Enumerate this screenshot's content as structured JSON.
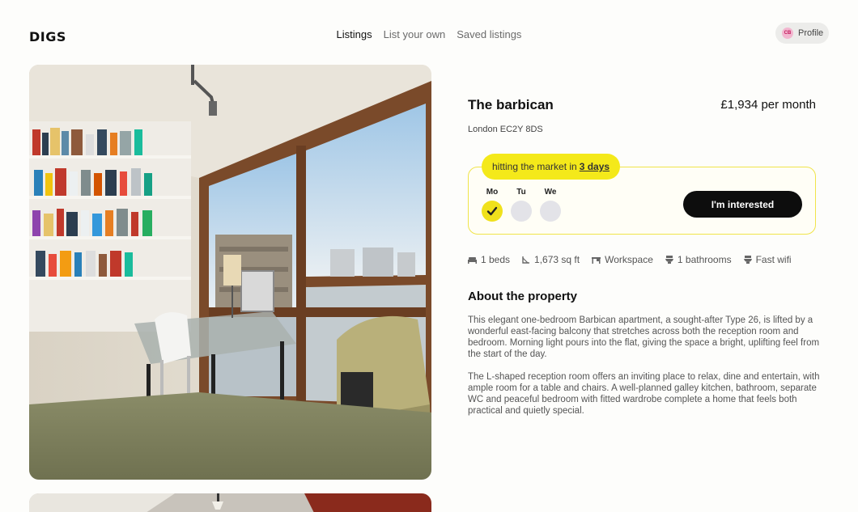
{
  "header": {
    "logo": "DIGS",
    "nav": [
      {
        "label": "Listings",
        "active": true
      },
      {
        "label": "List your own",
        "active": false
      },
      {
        "label": "Saved listings",
        "active": false
      }
    ],
    "profile": {
      "initials": "CB",
      "label": "Profile"
    }
  },
  "listing": {
    "title": "The barbican",
    "price": "£1,934 per month",
    "address": "London EC2Y 8DS",
    "market": {
      "prefix": "hitting the market in",
      "days": "3 days"
    },
    "viewing_days": [
      {
        "label": "Mo",
        "checked": true
      },
      {
        "label": "Tu",
        "checked": false
      },
      {
        "label": "We",
        "checked": false
      }
    ],
    "cta_label": "I'm interested",
    "features": [
      {
        "icon": "bed-icon",
        "label": "1 beds"
      },
      {
        "icon": "area-icon",
        "label": "1,673 sq ft"
      },
      {
        "icon": "workspace-icon",
        "label": "Workspace"
      },
      {
        "icon": "toilet-icon",
        "label": "1 bathrooms"
      },
      {
        "icon": "wifi-icon",
        "label": "Fast wifi"
      }
    ],
    "about": {
      "title": "About the property",
      "paragraphs": [
        "This elegant one-bedroom Barbican apartment, a sought-after Type 26, is lifted by a wonderful east-facing balcony that stretches across both the reception room and bedroom. Morning light pours into the flat, giving the space a bright, uplifting feel from the start of the day.",
        "The L-shaped reception room offers an inviting place to relax, dine and entertain, with ample room for a table and chairs. A well-planned galley kitchen, bathroom, separate WC and peaceful bedroom with fitted wardrobe complete a home that feels both practical and quietly special."
      ]
    }
  },
  "colors": {
    "accent": "#f4e91a",
    "button": "#0d0d0d",
    "background": "#fdfdfb"
  }
}
